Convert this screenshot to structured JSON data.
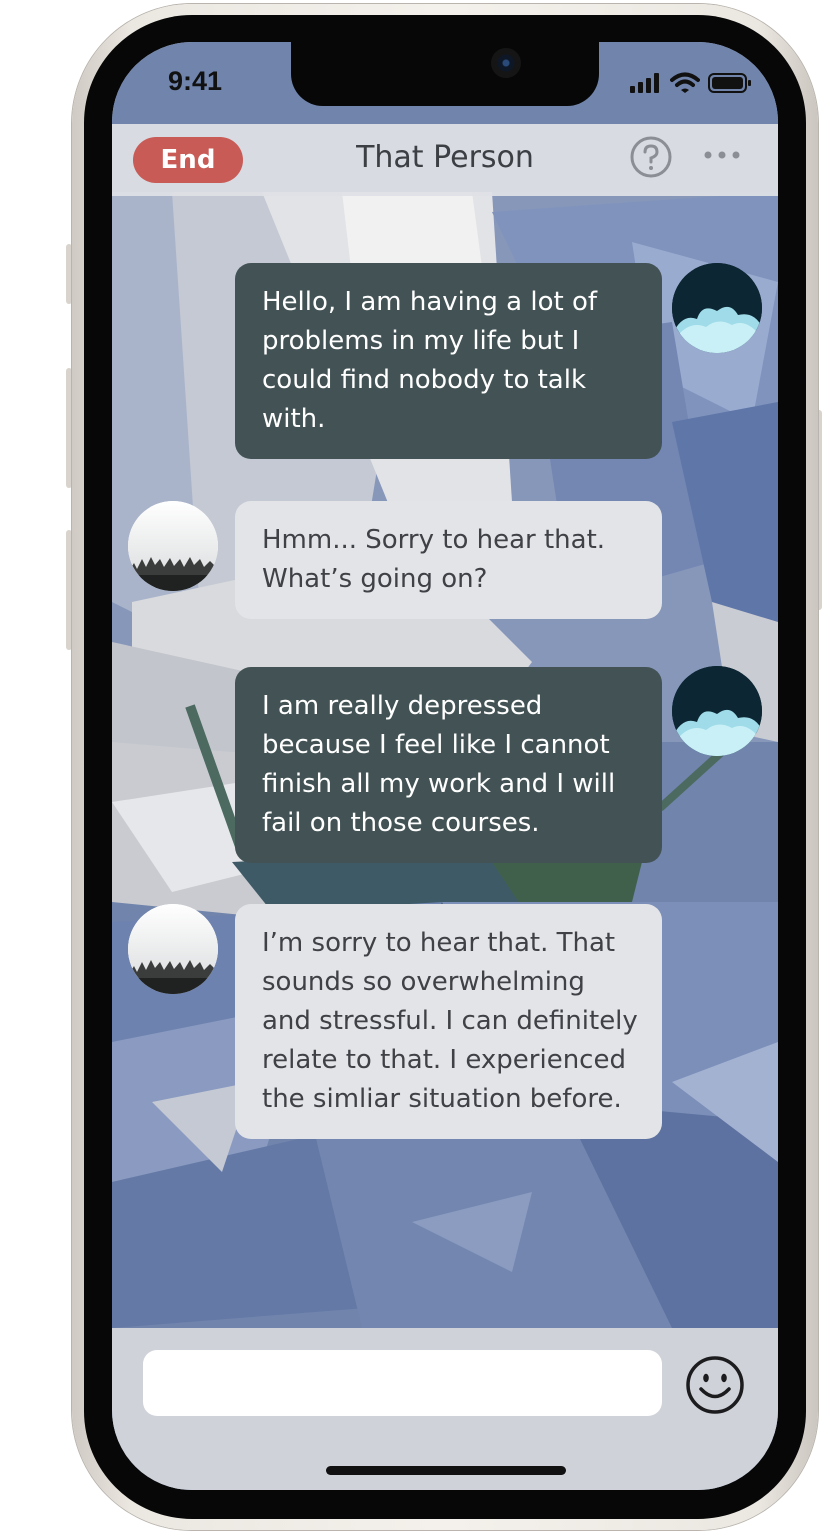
{
  "status_bar": {
    "time": "9:41",
    "icons": [
      "signal-icon",
      "wifi-icon",
      "battery-icon"
    ]
  },
  "header": {
    "end_label": "End",
    "title": "That Person",
    "icons": [
      "help-icon",
      "more-icon"
    ]
  },
  "messages": [
    {
      "sender": "me",
      "avatar": "cloud-avatar",
      "text": "Hello, I am having a lot of problems in my life but I could find nobody to talk with."
    },
    {
      "sender": "that_person",
      "avatar": "forest-avatar",
      "text": "Hmm... Sorry to hear that. What’s going on?"
    },
    {
      "sender": "me",
      "avatar": "cloud-avatar",
      "text": "I am really depressed because I feel like I cannot finish all my work and I will fail on those courses."
    },
    {
      "sender": "that_person",
      "avatar": "forest-avatar",
      "text": "I’m sorry to hear that. That sounds so overwhelming and stressful. I can definitely relate to that. I experienced the simliar situation before."
    }
  ],
  "composer": {
    "input_value": "",
    "input_placeholder": "",
    "emoji_icon": "smiley-icon"
  },
  "colors": {
    "end_button": "#c85b56",
    "my_bubble": "#435355",
    "their_bubble": "#e2e4e8",
    "background": "#6f83ab"
  }
}
